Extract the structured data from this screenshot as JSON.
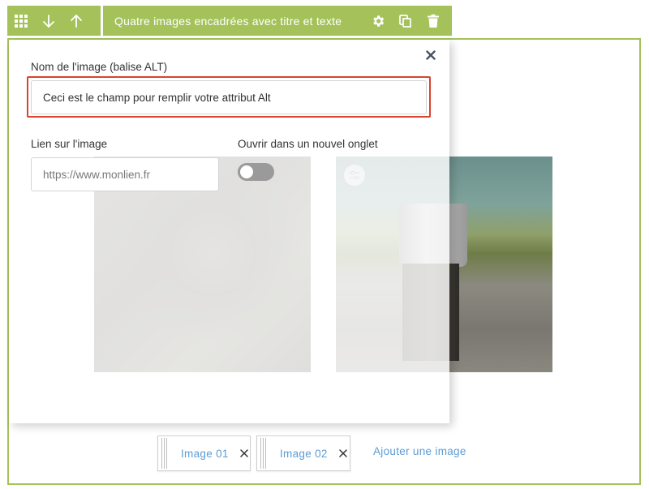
{
  "toolbar": {
    "block_title": "Quatre images encadrées avec titre et texte",
    "left_icons": [
      "grid-icon",
      "arrow-down-icon",
      "arrow-up-icon"
    ],
    "right_icons": [
      "gear-icon",
      "duplicate-icon",
      "trash-icon"
    ],
    "color": "#a4c15a"
  },
  "editor": {
    "alt_label": "Nom de l'image (balise ALT)",
    "alt_value": "Ceci est le champ pour remplir votre attribut Alt",
    "link_label": "Lien sur l'image",
    "link_placeholder": "https://www.monlien.fr",
    "new_tab_label": "Ouvrir dans un nouvel onglet",
    "new_tab_enabled": false,
    "highlight_color": "#d9432f"
  },
  "images": [
    {
      "label": "Image 01"
    },
    {
      "label": "Image 02"
    }
  ],
  "add_image_label": "Ajouter une image",
  "link_color": "#5b9bd5"
}
